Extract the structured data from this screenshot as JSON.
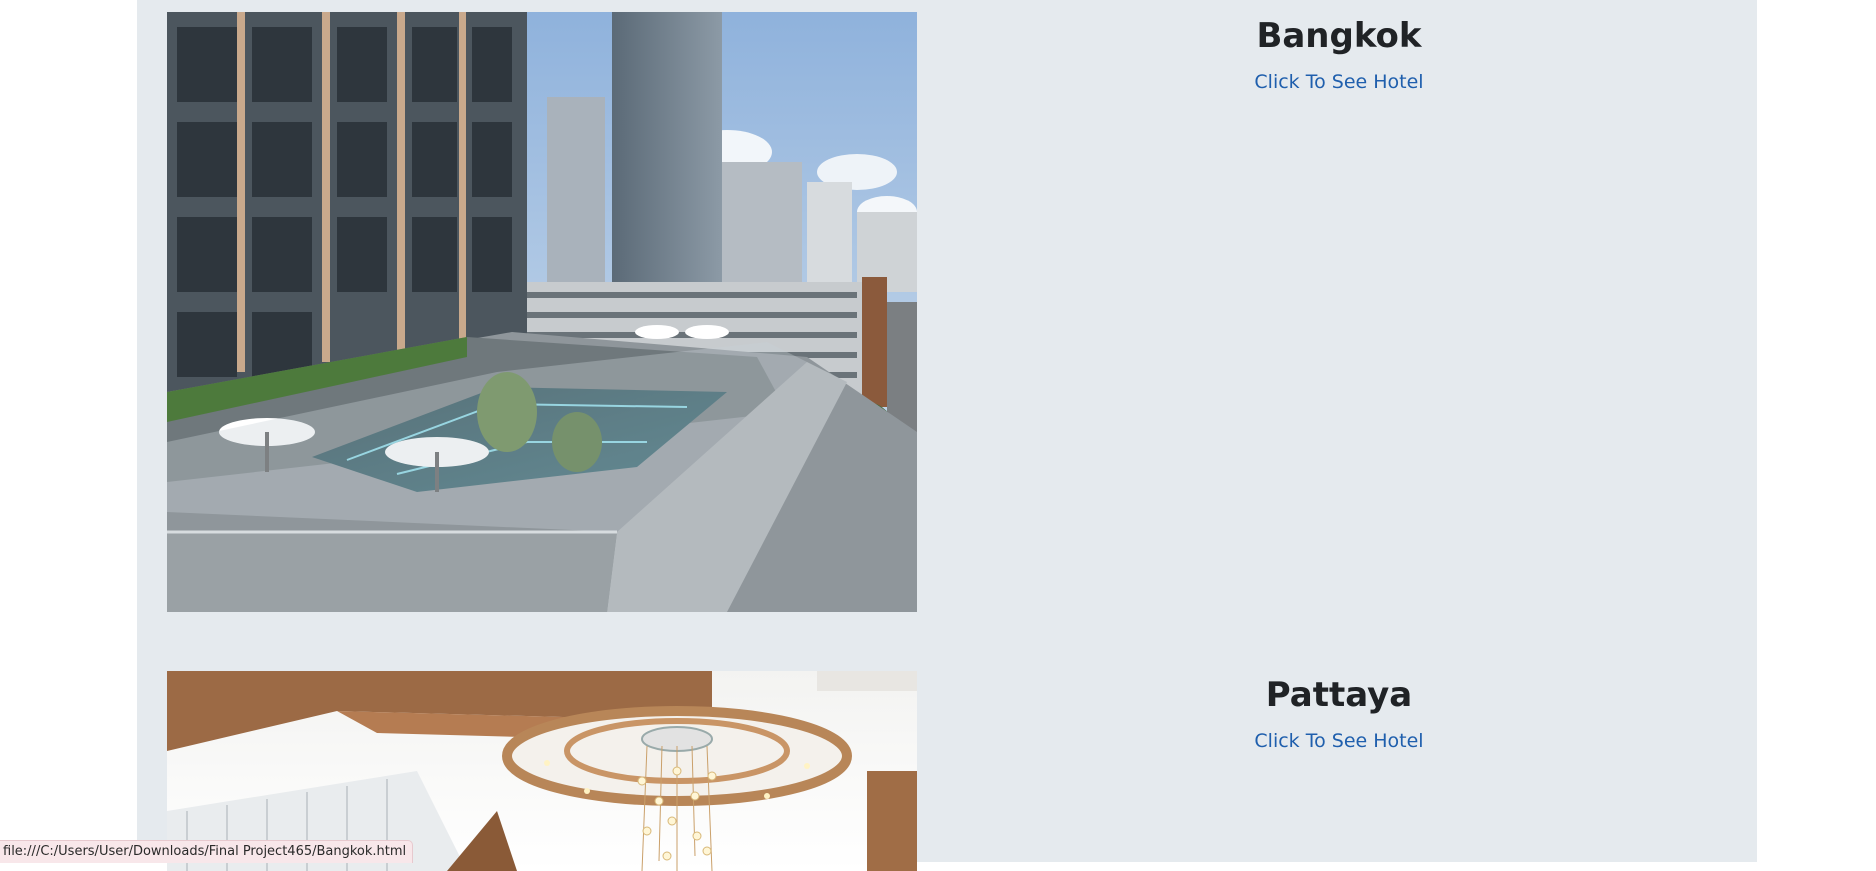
{
  "cities": [
    {
      "name": "Bangkok",
      "link_label": "Click To See Hotel",
      "image": "rooftop-pool-hotel-photo"
    },
    {
      "name": "Pattaya",
      "link_label": "Click To See Hotel",
      "image": "hotel-lobby-chandelier-photo"
    }
  ],
  "status_bar": {
    "url": "file:///C:/Users/User/Downloads/Final Project465/Bangkok.html"
  }
}
